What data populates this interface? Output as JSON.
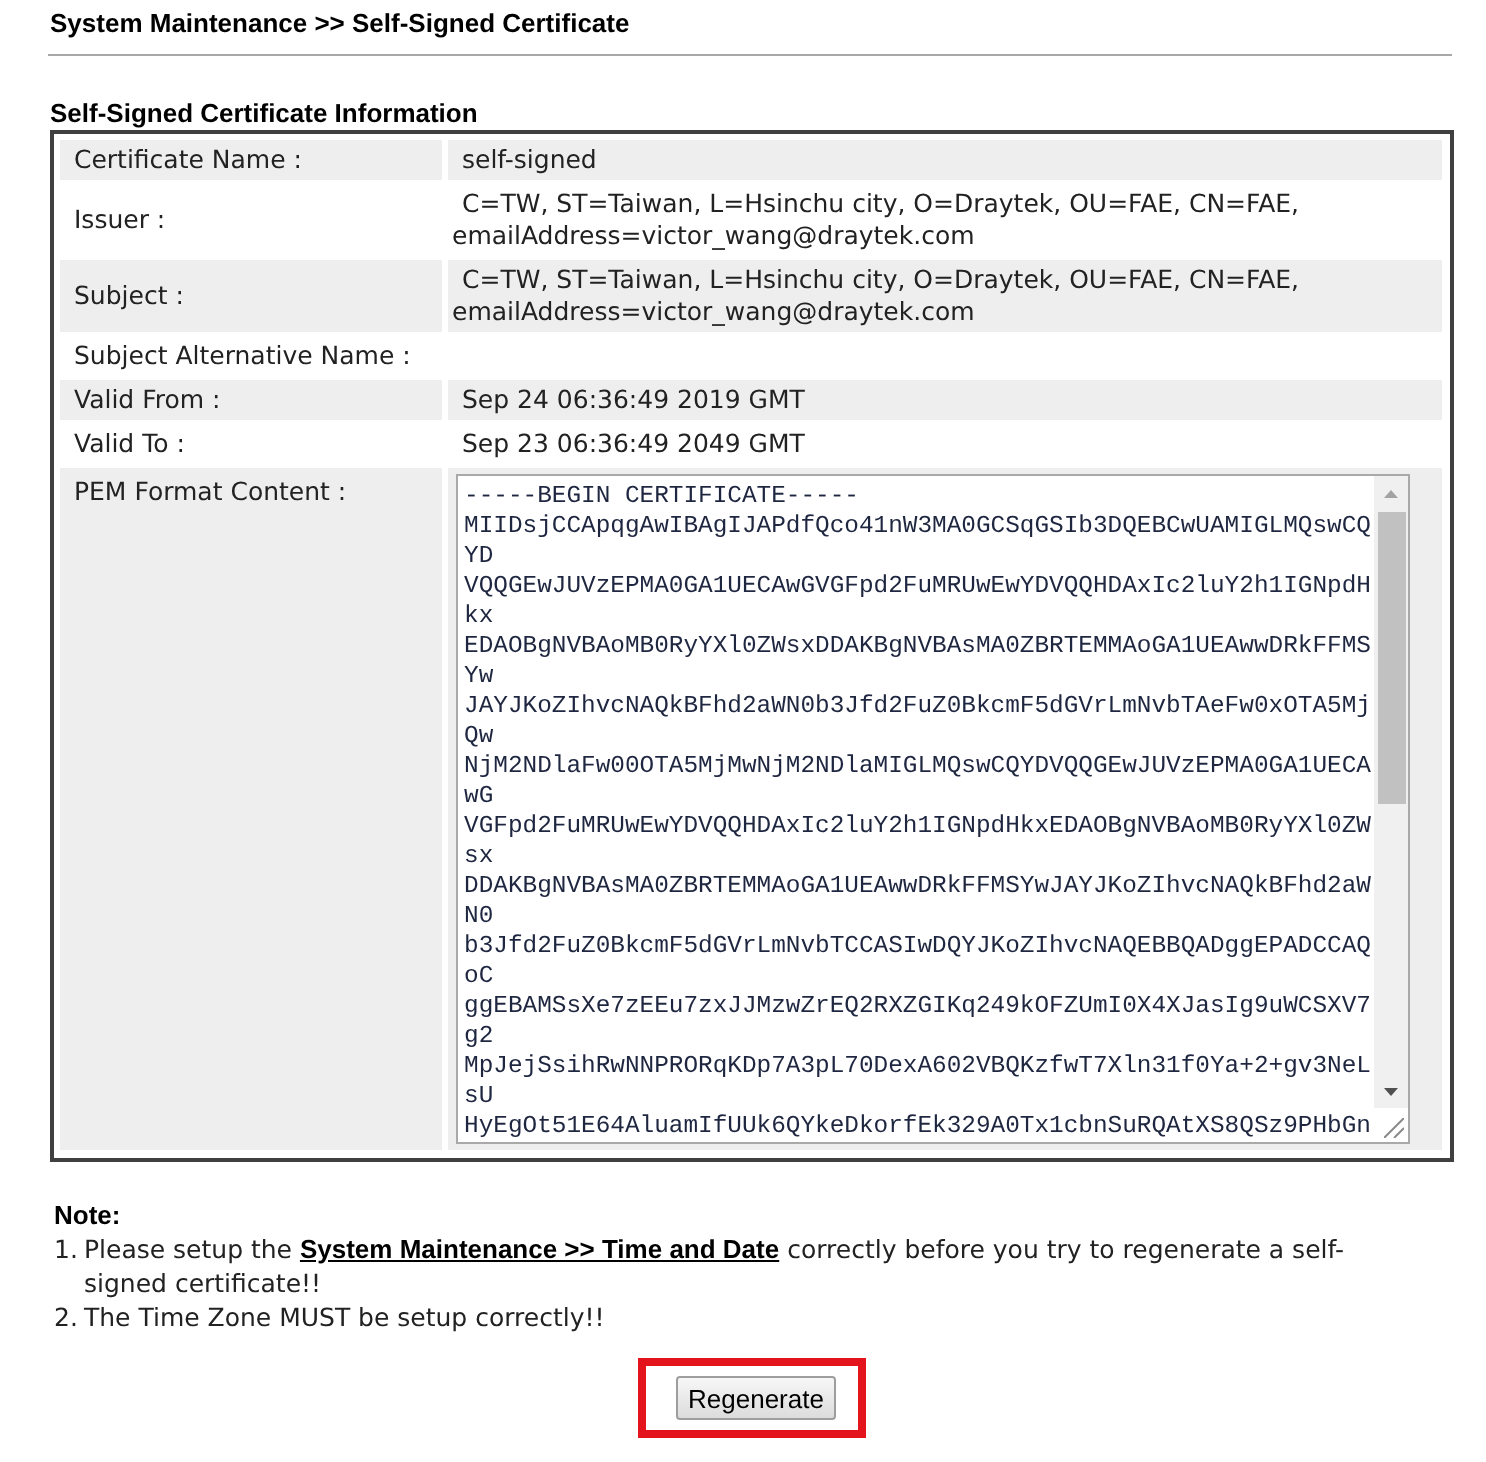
{
  "breadcrumb": "System Maintenance >> Self-Signed Certificate",
  "section_title": "Self-Signed Certificate Information",
  "fields": [
    {
      "kind": "text",
      "label": "Certificate Name :",
      "value": "self-signed"
    },
    {
      "kind": "text",
      "label": "Issuer :",
      "value": "C=TW, ST=Taiwan, L=Hsinchu city, O=Draytek, OU=FAE, CN=FAE, emailAddress=victor_wang@draytek.com"
    },
    {
      "kind": "text",
      "label": "Subject :",
      "value": "C=TW, ST=Taiwan, L=Hsinchu city, O=Draytek, OU=FAE, CN=FAE, emailAddress=victor_wang@draytek.com"
    },
    {
      "kind": "text",
      "label": "Subject Alternative Name :"
    },
    {
      "kind": "text",
      "label": "Valid From :",
      "value": "Sep 24 06:36:49 2019 GMT"
    },
    {
      "kind": "text",
      "label": "Valid To :",
      "value": "Sep 23 06:36:49 2049 GMT"
    },
    {
      "kind": "pem",
      "label": "PEM Format Content :",
      "lines": [
        "-----BEGIN CERTIFICATE-----",
        "MIIDsjCCApqgAwIBAgIJAPdfQco41nW3MA0GCSqGSIb3DQEBCwUAMIGLMQswCQYD",
        "VQQGEwJUVzEPMA0GA1UECAwGVGFpd2FuMRUwEwYDVQQHDAxIc2luY2h1IGNpdHkx",
        "EDAOBgNVBAoMB0RyYXl0ZWsxDDAKBgNVBAsMA0ZBRTEMMAoGA1UEAwwDRkFFMSYw",
        "JAYJKoZIhvcNAQkBFhd2aWN0b3Jfd2FuZ0BkcmF5dGVrLmNvbTAeFw0xOTA5MjQw",
        "NjM2NDlaFw00OTA5MjMwNjM2NDlaMIGLMQswCQYDVQQGEwJUVzEPMA0GA1UECAwG",
        "VGFpd2FuMRUwEwYDVQQHDAxIc2luY2h1IGNpdHkxEDAOBgNVBAoMB0RyYXl0ZWsx",
        "DDAKBgNVBAsMA0ZBRTEMMAoGA1UEAwwDRkFFMSYwJAYJKoZIhvcNAQkBFhd2aWN0",
        "b3Jfd2FuZ0BkcmF5dGVrLmNvbTCCASIwDQYJKoZIhvcNAQEBBQADggEPADCCAQoC",
        "ggEBAMSsXe7zEEu7zxJJMzwZrEQ2RXZGIKq249kOFZUmI0X4XJasIg9uWCSXV7g2",
        "MpJejSsihRwNNPRORqKDp7A3pL70DexA602VBQKzfwT7Xln31f0Ya+2+gv3NeLsU",
        "HyEgOt51E64AluamIfUUk6QYkeDkorfEk329A0Tx1cbnSuRQAtXS8QSz9PHbGn"
      ]
    }
  ],
  "note": {
    "title": "Note:",
    "items": [
      {
        "number": "1.",
        "text": "Please setup the ",
        "link": "System Maintenance >> Time and Date",
        "text_after": " correctly before you try to regenerate a self-signed certificate!!"
      },
      {
        "number": "2.",
        "text": "The Time Zone MUST be setup correctly!!"
      }
    ]
  },
  "button": {
    "label": "Regenerate",
    "highlighted": true
  }
}
